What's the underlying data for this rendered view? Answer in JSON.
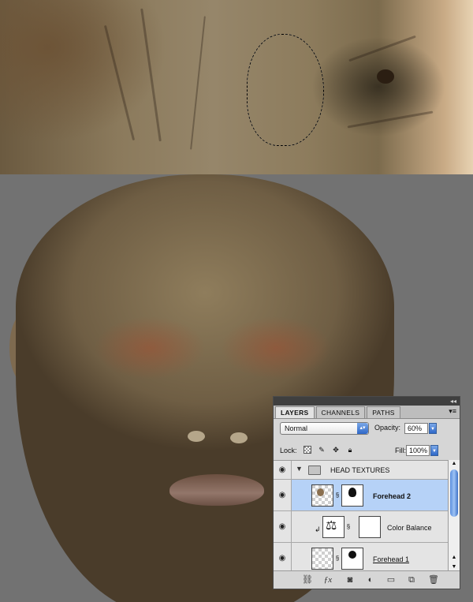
{
  "panel": {
    "tabs": [
      {
        "label": "LAYERS",
        "active": true
      },
      {
        "label": "CHANNELS",
        "active": false
      },
      {
        "label": "PATHS",
        "active": false
      }
    ],
    "blend_mode": "Normal",
    "opacity_label": "Opacity:",
    "opacity_value": "60%",
    "lock_label": "Lock:",
    "fill_label": "Fill:",
    "fill_value": "100%",
    "layers": [
      {
        "name": "HEAD TEXTURES",
        "type": "group",
        "visible": true,
        "selected": false
      },
      {
        "name": "Forehead 2",
        "type": "layer",
        "visible": true,
        "selected": true
      },
      {
        "name": "Color Balance",
        "type": "adjustment",
        "visible": true,
        "selected": false
      },
      {
        "name": "Forehead 1",
        "type": "layer",
        "visible": true,
        "selected": false
      }
    ],
    "footer_icons": [
      "link-icon",
      "fx-icon",
      "mask-icon",
      "adjustment-icon",
      "group-folder-icon",
      "new-layer-icon",
      "trash-icon"
    ]
  },
  "colors": {
    "selected_row": "#b6d2f7",
    "accent": "#2f68c8"
  }
}
